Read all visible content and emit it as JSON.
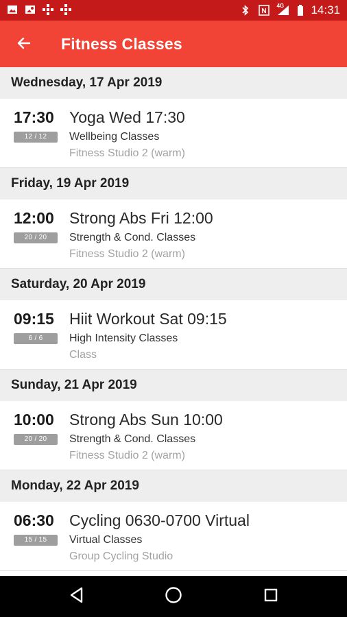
{
  "status_bar": {
    "time": "14:31",
    "network": "4G",
    "icons": [
      "image-icon",
      "gallery-icon",
      "grid-icon",
      "grid-icon",
      "bluetooth-icon",
      "nfc-icon",
      "signal-icon",
      "battery-icon"
    ]
  },
  "app_bar": {
    "title": "Fitness Classes",
    "back_icon": "arrow-left-icon",
    "color": "#f14336"
  },
  "days": [
    {
      "label": "Wednesday, 17 Apr 2019",
      "classes": [
        {
          "time": "17:30",
          "spaces": "12 / 12",
          "name": "Yoga Wed 17:30",
          "category": "Wellbeing Classes",
          "location": "Fitness Studio 2 (warm)"
        }
      ]
    },
    {
      "label": "Friday, 19 Apr 2019",
      "classes": [
        {
          "time": "12:00",
          "spaces": "20 / 20",
          "name": "Strong Abs Fri 12:00",
          "category": "Strength & Cond. Classes",
          "location": "Fitness Studio 2 (warm)"
        }
      ]
    },
    {
      "label": "Saturday, 20 Apr 2019",
      "classes": [
        {
          "time": "09:15",
          "spaces": "6 / 6",
          "name": "Hiit Workout Sat 09:15",
          "category": "High Intensity Classes",
          "location": "Class"
        }
      ]
    },
    {
      "label": "Sunday, 21 Apr 2019",
      "classes": [
        {
          "time": "10:00",
          "spaces": "20 / 20",
          "name": "Strong Abs Sun 10:00",
          "category": "Strength & Cond. Classes",
          "location": "Fitness Studio 2 (warm)"
        }
      ]
    },
    {
      "label": "Monday, 22 Apr 2019",
      "classes": [
        {
          "time": "06:30",
          "spaces": "15 / 15",
          "name": "Cycling 0630-0700 Virtual",
          "category": "Virtual Classes",
          "location": "Group Cycling Studio"
        }
      ]
    }
  ],
  "nav_bar": {
    "icons": [
      "back-triangle-icon",
      "home-circle-icon",
      "recents-square-icon"
    ]
  }
}
